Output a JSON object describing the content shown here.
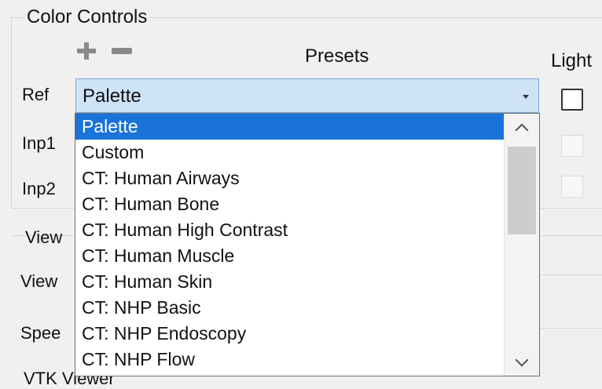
{
  "group": {
    "title": "Color Controls",
    "presets_label": "Presets",
    "light_label": "Light"
  },
  "toolbar": {
    "add_icon": "plus-icon",
    "remove_icon": "minus-icon"
  },
  "rows": {
    "ref": "Ref",
    "inp1": "Inp1",
    "inp2": "Inp2"
  },
  "combo": {
    "value": "Palette"
  },
  "dropdown": {
    "options": [
      "Palette",
      "Custom",
      "CT: Human Airways",
      "CT: Human Bone",
      "CT: Human High Contrast",
      "CT: Human Muscle",
      "CT: Human Skin",
      "CT: NHP Basic",
      "CT: NHP Endoscopy",
      "CT: NHP Flow"
    ]
  },
  "background": {
    "view1": "View",
    "view2": "View",
    "speed": "Spee",
    "vtk": "VTK Viewer"
  },
  "colors": {
    "selection": "#1a73d8",
    "combo_bg": "#cfe3f7",
    "window_bg": "#f0f0f0"
  }
}
